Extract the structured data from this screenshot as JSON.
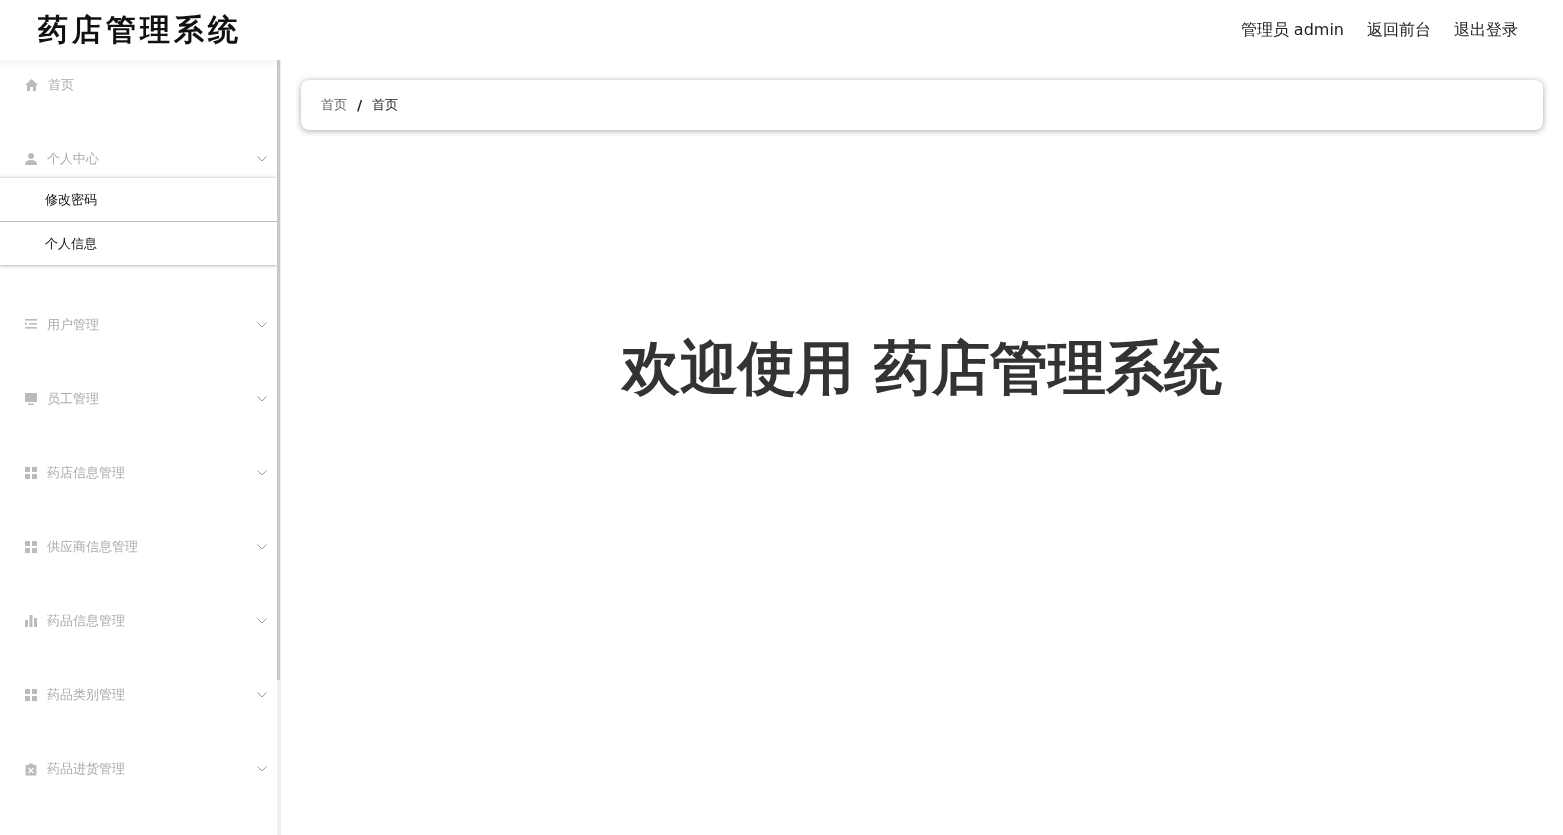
{
  "header": {
    "title": "药店管理系统",
    "user": "管理员 admin",
    "links": [
      "返回前台",
      "退出登录"
    ]
  },
  "sidebar": {
    "items": [
      {
        "kind": "link",
        "label": "首页"
      },
      {
        "kind": "submenu",
        "label": "个人中心",
        "children": [
          {
            "label": "修改密码"
          },
          {
            "label": "个人信息"
          }
        ]
      },
      {
        "kind": "submenu",
        "label": "用户管理"
      },
      {
        "kind": "submenu",
        "label": "员工管理"
      },
      {
        "kind": "submenu",
        "label": "药店信息管理"
      },
      {
        "kind": "submenu",
        "label": "供应商信息管理"
      },
      {
        "kind": "submenu",
        "label": "药品信息管理"
      },
      {
        "kind": "submenu",
        "label": "药品类别管理"
      },
      {
        "kind": "submenu",
        "label": "药品进货管理"
      }
    ]
  },
  "breadcrumb": [
    "首页",
    "首页"
  ],
  "breadcrumb_separator": "/",
  "welcome": "欢迎使用 药店管理系统"
}
